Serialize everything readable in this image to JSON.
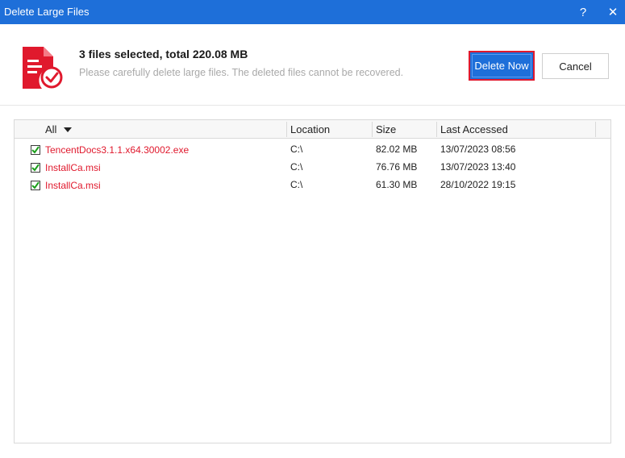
{
  "window": {
    "title": "Delete Large Files",
    "help_glyph": "?",
    "close_glyph": "✕"
  },
  "header": {
    "headline": "3 files selected, total 220.08 MB",
    "subline": "Please carefully delete large files. The deleted files cannot be recovered.",
    "delete_label": "Delete Now",
    "cancel_label": "Cancel",
    "icon": "document-delete-icon"
  },
  "table": {
    "columns": [
      "All",
      "Location",
      "Size",
      "Last Accessed"
    ],
    "rows": [
      {
        "name": "TencentDocs3.1.1.x64.30002.exe",
        "location": "C:\\",
        "size": "82.02 MB",
        "last_accessed": "13/07/2023 08:56",
        "checked": true
      },
      {
        "name": "InstallCa.msi",
        "location": "C:\\",
        "size": "76.76 MB",
        "last_accessed": "13/07/2023 13:40",
        "checked": true
      },
      {
        "name": "InstallCa.msi",
        "location": "C:\\",
        "size": "61.30 MB",
        "last_accessed": "28/10/2022 19:15",
        "checked": true
      }
    ]
  },
  "colors": {
    "accent": "#1e6fd9",
    "danger": "#e0192d",
    "check": "#1a9e1a"
  }
}
